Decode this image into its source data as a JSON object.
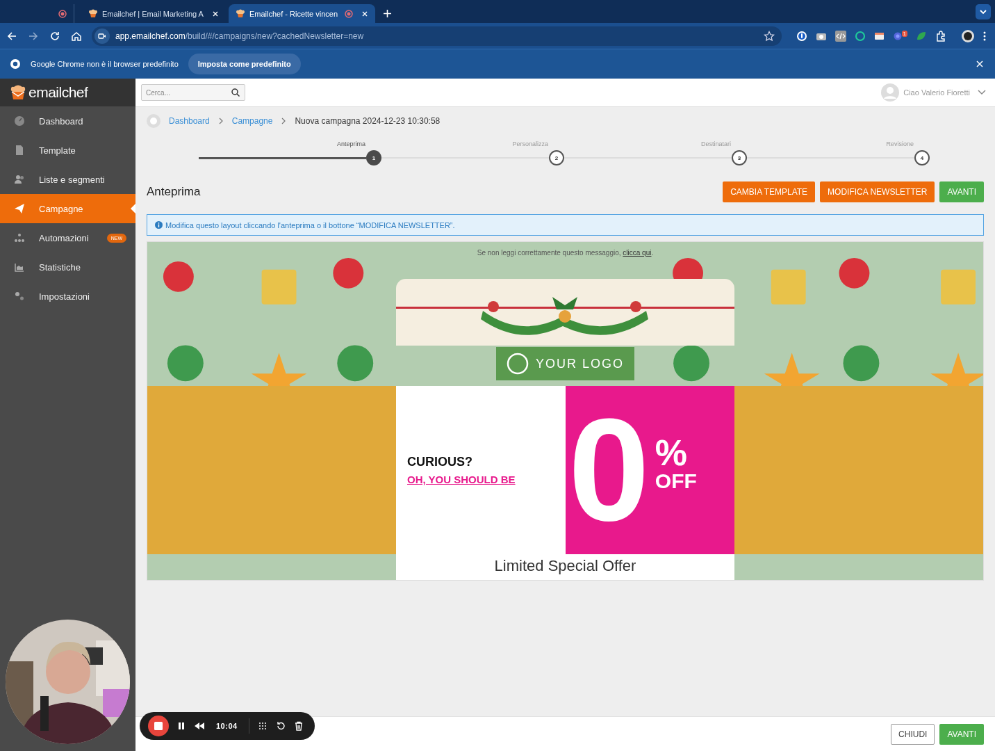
{
  "browser": {
    "tabs": [
      {
        "title": "Emailchef | Email Marketing A",
        "selected": false,
        "recording": false
      },
      {
        "title": "Emailchef - Ricette vincen",
        "selected": true,
        "recording": true
      }
    ],
    "url": {
      "host": "app.emailchef.com",
      "path": "/build/#/campaigns/new?cachedNewsletter=new"
    },
    "extension_badge": "1",
    "infobar": {
      "message": "Google Chrome non è il browser predefinito",
      "button": "Imposta come predefinito"
    }
  },
  "app": {
    "logo": "emailchef",
    "search": {
      "placeholder": "Cerca..."
    },
    "user": "Ciao Valerio Fioretti",
    "sidebar": [
      {
        "label": "Dashboard",
        "selected": false
      },
      {
        "label": "Template",
        "selected": false
      },
      {
        "label": "Liste e segmenti",
        "selected": false
      },
      {
        "label": "Campagne",
        "selected": true
      },
      {
        "label": "Automazioni",
        "selected": false,
        "badge": "NEW"
      },
      {
        "label": "Statistiche",
        "selected": false
      },
      {
        "label": "Impostazioni",
        "selected": false
      }
    ],
    "breadcrumb": [
      {
        "label": "Dashboard",
        "link": true
      },
      {
        "label": "Campagne",
        "link": true
      },
      {
        "label": "Nuova campagna 2024-12-23 10:30:58",
        "link": false
      }
    ],
    "steps": [
      {
        "label": "Anteprima",
        "number": "1",
        "selected": true
      },
      {
        "label": "Personalizza",
        "number": "2",
        "selected": false
      },
      {
        "label": "Destinatari",
        "number": "3",
        "selected": false
      },
      {
        "label": "Revisione",
        "number": "4",
        "selected": false
      }
    ],
    "title": "Anteprima",
    "actions": [
      {
        "label": "CAMBIA TEMPLATE",
        "kind": "warning"
      },
      {
        "label": "MODIFICA NEWSLETTER",
        "kind": "warning"
      },
      {
        "label": "AVANTI",
        "kind": "success"
      }
    ],
    "notice": "Modifica questo layout cliccando l'anteprima o il bottone “MODIFICA NEWSLETTER”.",
    "preview": {
      "notice": "Se non leggi correttamente questo messaggio, ",
      "notice_link": "clicca qui",
      "notice_end": ".",
      "logo": "YOUR LOGO",
      "headline": "CURIOUS?",
      "subheadline": "OH, YOU SHOULD BE",
      "discount": "0",
      "percent": "%",
      "off": "OFF",
      "offer": "Limited Special Offer"
    },
    "footer": [
      {
        "label": "CHIUDI",
        "kind": "default"
      },
      {
        "label": "AVANTI",
        "kind": "success"
      }
    ]
  },
  "recorder": {
    "time": "10:04"
  }
}
